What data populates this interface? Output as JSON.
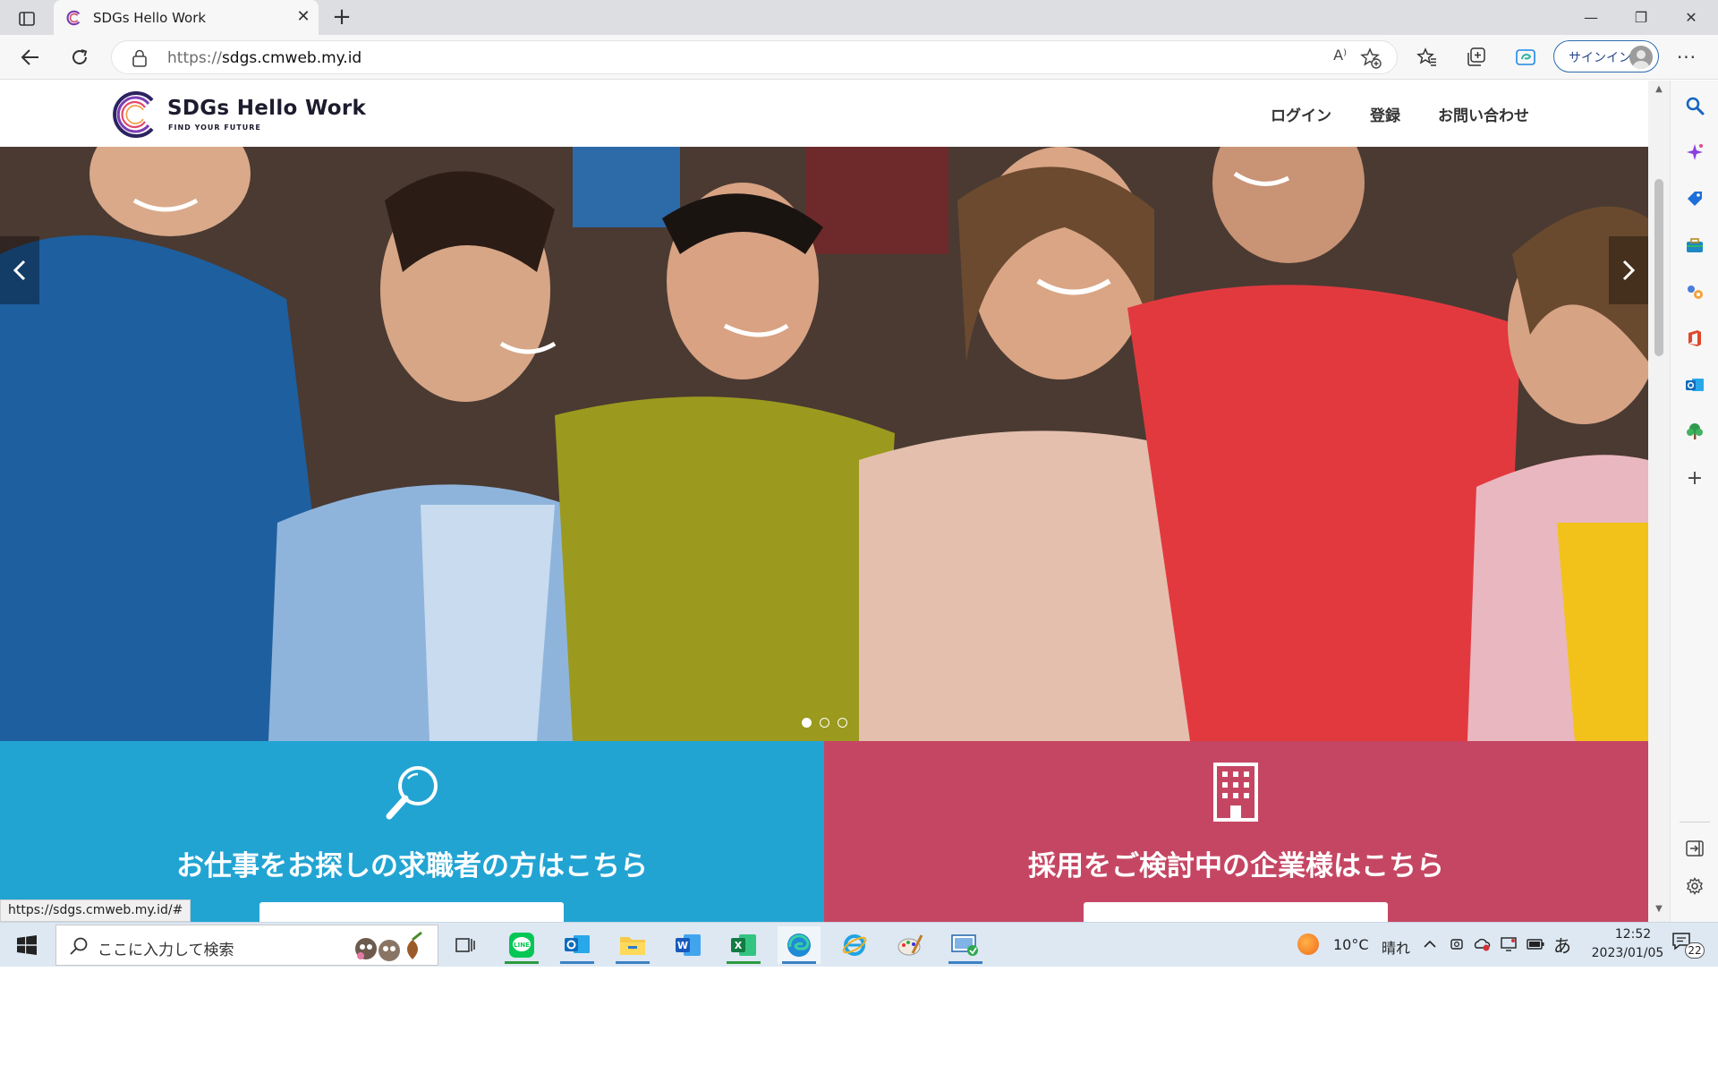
{
  "browser": {
    "tab": {
      "title": "SDGs Hello Work",
      "close_glyph": "✕"
    },
    "new_tab_glyph": "+",
    "window": {
      "minimize_glyph": "—",
      "maximize_glyph": "❐",
      "close_glyph": "✕"
    },
    "address": {
      "scheme": "https://",
      "host": "sdgs.cmweb.my.id"
    },
    "read_aloud_glyph": "A⁾",
    "signin_label": "サインイン",
    "more_glyph": "···",
    "status_url": "https://sdgs.cmweb.my.id/#"
  },
  "site": {
    "name": "SDGs Hello Work",
    "tagline": "FIND YOUR FUTURE",
    "nav": {
      "login": "ログイン",
      "register": "登録",
      "contact": "お問い合わせ"
    },
    "hero": {
      "slide_count": 3,
      "active_slide": 1
    },
    "cta_seeker": {
      "title": "お仕事をお探しの求職者の方はこちら",
      "color": "#22a4d3",
      "icon": "magnifier-icon"
    },
    "cta_employer": {
      "title": "採用をご検討中の企業様はこちら",
      "color": "#c54663",
      "icon": "building-icon"
    }
  },
  "taskbar": {
    "search_placeholder": "ここに入力して検索",
    "weather_temp": "10°C",
    "weather_text": "晴れ",
    "ime_mode": "あ",
    "time": "12:52",
    "date": "2023/01/05",
    "notification_count": "22",
    "apps": [
      "task-view-icon",
      "line-icon",
      "outlook-icon",
      "file-explorer-icon",
      "word-icon",
      "excel-icon",
      "edge-icon",
      "internet-explorer-icon",
      "paint-icon",
      "remote-desktop-icon"
    ]
  },
  "colors": {
    "accent_blue": "#22a4d3",
    "accent_red": "#c54663",
    "edge_blue": "#2b6cb0"
  }
}
